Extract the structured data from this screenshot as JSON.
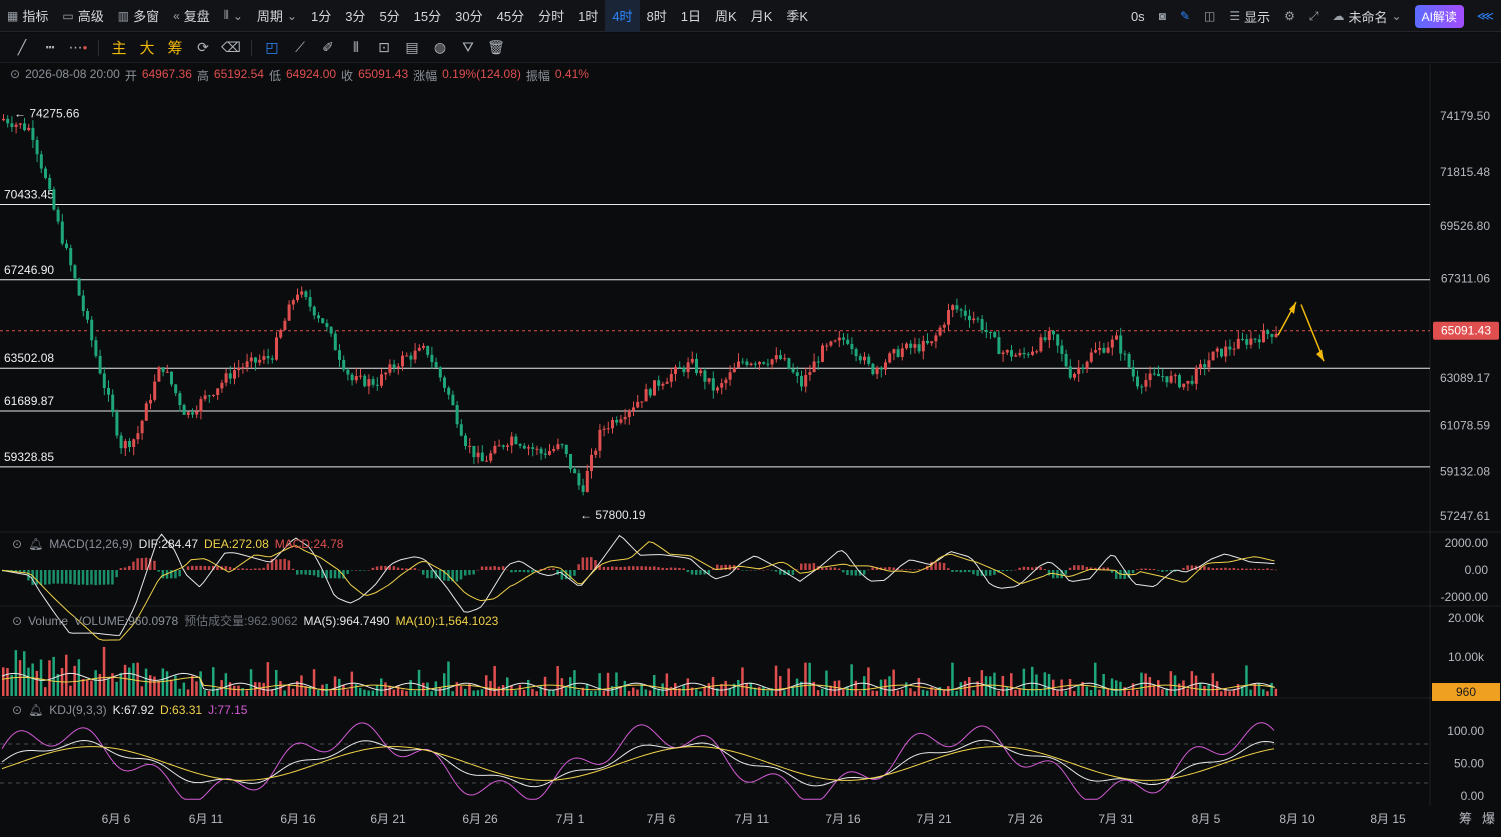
{
  "toolbar": {
    "indicators": "指标",
    "advanced": "高级",
    "multi_window": "多窗",
    "replay": "复盘",
    "period_label": "周期",
    "timeframes": [
      "1分",
      "3分",
      "5分",
      "15分",
      "30分",
      "45分",
      "分时",
      "1时",
      "4时",
      "8时",
      "1日",
      "周K",
      "月K",
      "季K"
    ],
    "active_timeframe": "4时",
    "latency": "0s",
    "display": "显示",
    "layout_name": "未命名",
    "ai_button": "AI解读"
  },
  "draw_tools": {
    "main": "主",
    "large": "大",
    "chips": "筹"
  },
  "ohlc": {
    "date": "2026-08-08 20:00",
    "open_label": "开",
    "open": "64967.36",
    "high_label": "高",
    "high": "65192.54",
    "low_label": "低",
    "low": "64924.00",
    "close_label": "收",
    "close": "65091.43",
    "change_label": "涨幅",
    "change": "0.19%(124.08)",
    "amplitude_label": "振幅",
    "amplitude": "0.41%"
  },
  "price_axis": [
    "74179.50",
    "71815.48",
    "69526.80",
    "67311.06",
    "65091.43",
    "63089.17",
    "61078.59",
    "59132.08",
    "57247.61"
  ],
  "current_price": "65091.43",
  "horizontal_lines": [
    "70433.45",
    "67246.90",
    "63502.08",
    "61689.87",
    "59328.85"
  ],
  "high_marker": "74275.66",
  "low_marker": "57800.19",
  "macd": {
    "name": "MACD(12,26,9)",
    "dif": "DIF:284.47",
    "dea": "DEA:272.08",
    "macd": "MACD:24.78",
    "axis": [
      "2000.00",
      "0.00",
      "-2000.00"
    ]
  },
  "volume": {
    "name": "Volume",
    "vol": "VOLUME:960.0978",
    "est": "预估成交量:962.9062",
    "ma5": "MA(5):964.7490",
    "ma10": "MA(10):1,564.1023",
    "axis": [
      "20.00k",
      "10.00k"
    ],
    "current": "960"
  },
  "kdj": {
    "name": "KDJ(9,3,3)",
    "k": "K:67.92",
    "d": "D:63.31",
    "j": "J:77.15",
    "axis": [
      "100.00",
      "50.00",
      "0.00"
    ]
  },
  "date_axis": [
    "6月 6",
    "6月 11",
    "6月 16",
    "6月 21",
    "6月 26",
    "7月 1",
    "7月 6",
    "7月 11",
    "7月 16",
    "7月 21",
    "7月 26",
    "7月 31",
    "8月 5",
    "8月 10",
    "8月 15"
  ],
  "bottom_right": [
    "筹",
    "爆"
  ],
  "colors": {
    "up": "#e04f4f",
    "down": "#1fa67a",
    "active": "#2f86ff",
    "dea": "#f0d24a",
    "kdj_j": "#d35bd6",
    "price_tag": "#e04f4f",
    "volume_tag": "#f0a020"
  }
}
